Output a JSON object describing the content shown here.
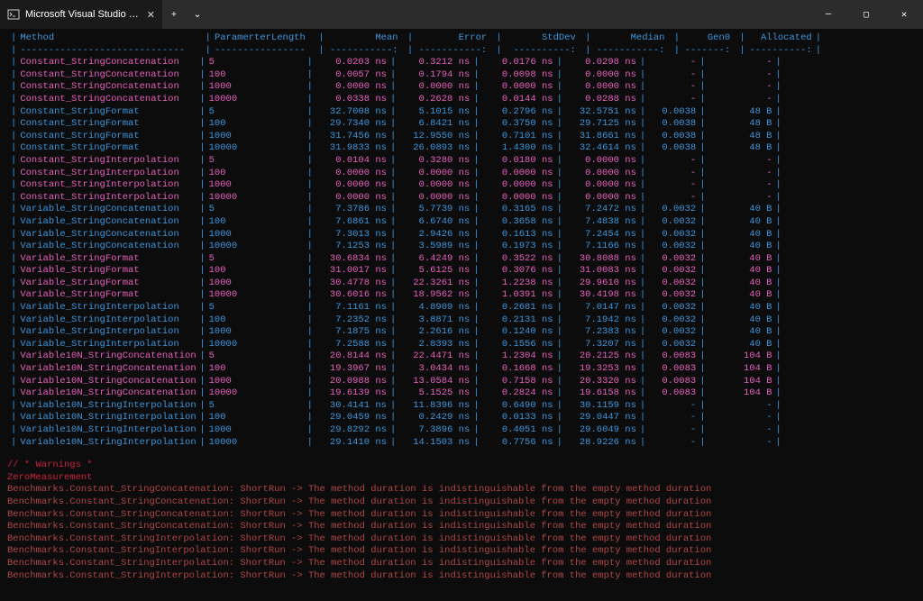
{
  "window": {
    "tab_title": "Microsoft Visual Studio Debug...",
    "add_tab": "+",
    "dropdown": "⌄",
    "min_icon": "—",
    "max_icon": "▢",
    "close_icon": "✕"
  },
  "headers": {
    "method": "Method",
    "param": "ParamerterLength",
    "mean": "Mean",
    "error": "Error",
    "stddev": "StdDev",
    "median": "Median",
    "gen0": "Gen0",
    "alloc": "Allocated"
  },
  "rows": [
    {
      "g": 1,
      "method": "Constant_StringConcatenation",
      "param": "5",
      "mean": "0.0203 ns",
      "err": "0.3212 ns",
      "sd": "0.0176 ns",
      "med": "0.0298 ns",
      "gen0": "-",
      "alloc": "-"
    },
    {
      "g": 1,
      "method": "Constant_StringConcatenation",
      "param": "100",
      "mean": "0.0057 ns",
      "err": "0.1794 ns",
      "sd": "0.0098 ns",
      "med": "0.0000 ns",
      "gen0": "-",
      "alloc": "-"
    },
    {
      "g": 1,
      "method": "Constant_StringConcatenation",
      "param": "1000",
      "mean": "0.0000 ns",
      "err": "0.0000 ns",
      "sd": "0.0000 ns",
      "med": "0.0000 ns",
      "gen0": "-",
      "alloc": "-"
    },
    {
      "g": 1,
      "method": "Constant_StringConcatenation",
      "param": "10000",
      "mean": "0.0338 ns",
      "err": "0.2628 ns",
      "sd": "0.0144 ns",
      "med": "0.0288 ns",
      "gen0": "-",
      "alloc": "-"
    },
    {
      "g": 0,
      "method": "Constant_StringFormat",
      "param": "5",
      "mean": "32.7008 ns",
      "err": "5.1015 ns",
      "sd": "0.2796 ns",
      "med": "32.5751 ns",
      "gen0": "0.0038",
      "alloc": "48 B"
    },
    {
      "g": 0,
      "method": "Constant_StringFormat",
      "param": "100",
      "mean": "29.7340 ns",
      "err": "6.8421 ns",
      "sd": "0.3750 ns",
      "med": "29.7125 ns",
      "gen0": "0.0038",
      "alloc": "48 B"
    },
    {
      "g": 0,
      "method": "Constant_StringFormat",
      "param": "1000",
      "mean": "31.7456 ns",
      "err": "12.9550 ns",
      "sd": "0.7101 ns",
      "med": "31.8661 ns",
      "gen0": "0.0038",
      "alloc": "48 B"
    },
    {
      "g": 0,
      "method": "Constant_StringFormat",
      "param": "10000",
      "mean": "31.9833 ns",
      "err": "26.0893 ns",
      "sd": "1.4300 ns",
      "med": "32.4614 ns",
      "gen0": "0.0038",
      "alloc": "48 B"
    },
    {
      "g": 1,
      "method": "Constant_StringInterpolation",
      "param": "5",
      "mean": "0.0104 ns",
      "err": "0.3280 ns",
      "sd": "0.0180 ns",
      "med": "0.0000 ns",
      "gen0": "-",
      "alloc": "-"
    },
    {
      "g": 1,
      "method": "Constant_StringInterpolation",
      "param": "100",
      "mean": "0.0000 ns",
      "err": "0.0000 ns",
      "sd": "0.0000 ns",
      "med": "0.0000 ns",
      "gen0": "-",
      "alloc": "-"
    },
    {
      "g": 1,
      "method": "Constant_StringInterpolation",
      "param": "1000",
      "mean": "0.0000 ns",
      "err": "0.0000 ns",
      "sd": "0.0000 ns",
      "med": "0.0000 ns",
      "gen0": "-",
      "alloc": "-"
    },
    {
      "g": 1,
      "method": "Constant_StringInterpolation",
      "param": "10000",
      "mean": "0.0000 ns",
      "err": "0.0000 ns",
      "sd": "0.0000 ns",
      "med": "0.0000 ns",
      "gen0": "-",
      "alloc": "-"
    },
    {
      "g": 0,
      "method": "Variable_StringConcatenation",
      "param": "5",
      "mean": "7.3786 ns",
      "err": "5.7739 ns",
      "sd": "0.3165 ns",
      "med": "7.2472 ns",
      "gen0": "0.0032",
      "alloc": "40 B"
    },
    {
      "g": 0,
      "method": "Variable_StringConcatenation",
      "param": "100",
      "mean": "7.6861 ns",
      "err": "6.6740 ns",
      "sd": "0.3658 ns",
      "med": "7.4838 ns",
      "gen0": "0.0032",
      "alloc": "40 B"
    },
    {
      "g": 0,
      "method": "Variable_StringConcatenation",
      "param": "1000",
      "mean": "7.3013 ns",
      "err": "2.9426 ns",
      "sd": "0.1613 ns",
      "med": "7.2454 ns",
      "gen0": "0.0032",
      "alloc": "40 B"
    },
    {
      "g": 0,
      "method": "Variable_StringConcatenation",
      "param": "10000",
      "mean": "7.1253 ns",
      "err": "3.5989 ns",
      "sd": "0.1973 ns",
      "med": "7.1166 ns",
      "gen0": "0.0032",
      "alloc": "40 B"
    },
    {
      "g": 1,
      "method": "Variable_StringFormat",
      "param": "5",
      "mean": "30.6834 ns",
      "err": "6.4249 ns",
      "sd": "0.3522 ns",
      "med": "30.8088 ns",
      "gen0": "0.0032",
      "alloc": "40 B"
    },
    {
      "g": 1,
      "method": "Variable_StringFormat",
      "param": "100",
      "mean": "31.0017 ns",
      "err": "5.6125 ns",
      "sd": "0.3076 ns",
      "med": "31.0083 ns",
      "gen0": "0.0032",
      "alloc": "40 B"
    },
    {
      "g": 1,
      "method": "Variable_StringFormat",
      "param": "1000",
      "mean": "30.4778 ns",
      "err": "22.3261 ns",
      "sd": "1.2238 ns",
      "med": "29.9610 ns",
      "gen0": "0.0032",
      "alloc": "40 B"
    },
    {
      "g": 1,
      "method": "Variable_StringFormat",
      "param": "10000",
      "mean": "30.6016 ns",
      "err": "18.9562 ns",
      "sd": "1.0391 ns",
      "med": "30.4198 ns",
      "gen0": "0.0032",
      "alloc": "40 B"
    },
    {
      "g": 0,
      "method": "Variable_StringInterpolation",
      "param": "5",
      "mean": "7.1161 ns",
      "err": "4.8909 ns",
      "sd": "0.2681 ns",
      "med": "7.0147 ns",
      "gen0": "0.0032",
      "alloc": "40 B"
    },
    {
      "g": 0,
      "method": "Variable_StringInterpolation",
      "param": "100",
      "mean": "7.2352 ns",
      "err": "3.8871 ns",
      "sd": "0.2131 ns",
      "med": "7.1942 ns",
      "gen0": "0.0032",
      "alloc": "40 B"
    },
    {
      "g": 0,
      "method": "Variable_StringInterpolation",
      "param": "1000",
      "mean": "7.1875 ns",
      "err": "2.2616 ns",
      "sd": "0.1240 ns",
      "med": "7.2383 ns",
      "gen0": "0.0032",
      "alloc": "40 B"
    },
    {
      "g": 0,
      "method": "Variable_StringInterpolation",
      "param": "10000",
      "mean": "7.2588 ns",
      "err": "2.8393 ns",
      "sd": "0.1556 ns",
      "med": "7.3207 ns",
      "gen0": "0.0032",
      "alloc": "40 B"
    },
    {
      "g": 1,
      "method": "Variable10N_StringConcatenation",
      "param": "5",
      "mean": "20.8144 ns",
      "err": "22.4471 ns",
      "sd": "1.2304 ns",
      "med": "20.2125 ns",
      "gen0": "0.0083",
      "alloc": "104 B"
    },
    {
      "g": 1,
      "method": "Variable10N_StringConcatenation",
      "param": "100",
      "mean": "19.3967 ns",
      "err": "3.0434 ns",
      "sd": "0.1668 ns",
      "med": "19.3253 ns",
      "gen0": "0.0083",
      "alloc": "104 B"
    },
    {
      "g": 1,
      "method": "Variable10N_StringConcatenation",
      "param": "1000",
      "mean": "20.0988 ns",
      "err": "13.0584 ns",
      "sd": "0.7158 ns",
      "med": "20.3320 ns",
      "gen0": "0.0083",
      "alloc": "104 B"
    },
    {
      "g": 1,
      "method": "Variable10N_StringConcatenation",
      "param": "10000",
      "mean": "19.6139 ns",
      "err": "5.1525 ns",
      "sd": "0.2824 ns",
      "med": "19.6158 ns",
      "gen0": "0.0083",
      "alloc": "104 B"
    },
    {
      "g": 0,
      "method": "Variable10N_StringInterpolation",
      "param": "5",
      "mean": "30.4141 ns",
      "err": "11.8396 ns",
      "sd": "0.6490 ns",
      "med": "30.1159 ns",
      "gen0": "-",
      "alloc": "-"
    },
    {
      "g": 0,
      "method": "Variable10N_StringInterpolation",
      "param": "100",
      "mean": "29.0459 ns",
      "err": "0.2429 ns",
      "sd": "0.0133 ns",
      "med": "29.0447 ns",
      "gen0": "-",
      "alloc": "-"
    },
    {
      "g": 0,
      "method": "Variable10N_StringInterpolation",
      "param": "1000",
      "mean": "29.8292 ns",
      "err": "7.3896 ns",
      "sd": "0.4051 ns",
      "med": "29.6049 ns",
      "gen0": "-",
      "alloc": "-"
    },
    {
      "g": 0,
      "method": "Variable10N_StringInterpolation",
      "param": "10000",
      "mean": "29.1410 ns",
      "err": "14.1503 ns",
      "sd": "0.7756 ns",
      "med": "28.9226 ns",
      "gen0": "-",
      "alloc": "-"
    }
  ],
  "warnings": {
    "header": "// * Warnings *",
    "varname": "ZeroMeasurement",
    "lines": [
      "Benchmarks.Constant_StringConcatenation: ShortRun -> The method duration is indistinguishable from the empty method duration",
      "Benchmarks.Constant_StringConcatenation: ShortRun -> The method duration is indistinguishable from the empty method duration",
      "Benchmarks.Constant_StringConcatenation: ShortRun -> The method duration is indistinguishable from the empty method duration",
      "Benchmarks.Constant_StringConcatenation: ShortRun -> The method duration is indistinguishable from the empty method duration",
      "Benchmarks.Constant_StringInterpolation: ShortRun -> The method duration is indistinguishable from the empty method duration",
      "Benchmarks.Constant_StringInterpolation: ShortRun -> The method duration is indistinguishable from the empty method duration",
      "Benchmarks.Constant_StringInterpolation: ShortRun -> The method duration is indistinguishable from the empty method duration",
      "Benchmarks.Constant_StringInterpolation: ShortRun -> The method duration is indistinguishable from the empty method duration"
    ]
  }
}
